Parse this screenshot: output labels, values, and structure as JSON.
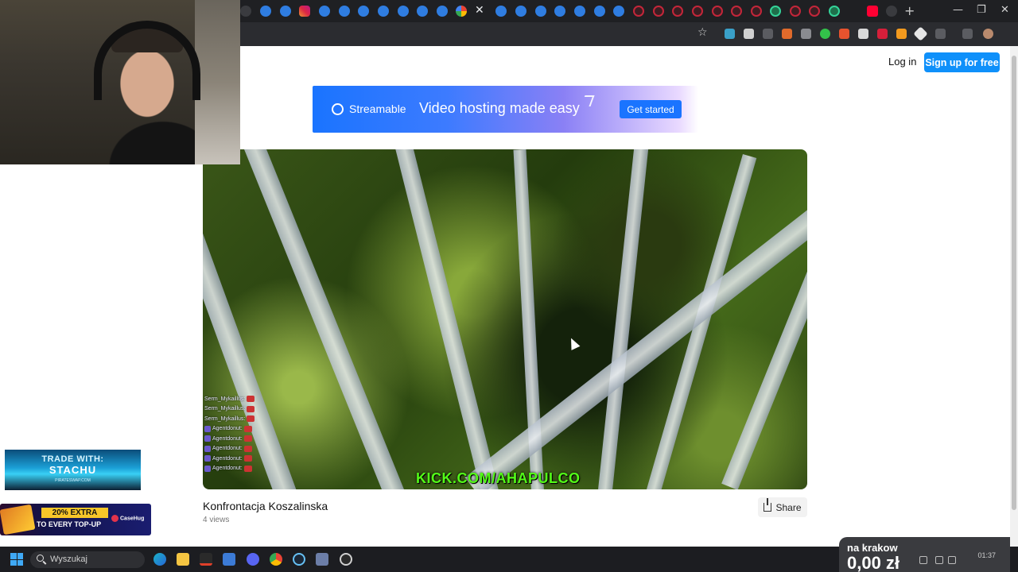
{
  "browser": {
    "toolbar_star": "☆",
    "new_tab": "+",
    "window_controls": {
      "minimize": "—",
      "restore": "❐",
      "close": "✕"
    },
    "active_tab_close": "✕"
  },
  "site": {
    "login_label": "Log in",
    "signup_label": "Sign up for free"
  },
  "banner": {
    "brand": "Streamable",
    "headline": "Video hosting made easy",
    "cta_label": "Get started"
  },
  "video": {
    "overlay_text": "KICK.COM/AHAPULCO",
    "title": "Konfrontacja Koszalinska",
    "views": "4 views",
    "share_label": "Share",
    "chat_names": [
      "Serm_Mykaillus:",
      "Serm_Mykaillus:",
      "Serm_Mykaillus:",
      "Agentdonut:",
      "Agentdonut:",
      "Agentdonut:",
      "Agentdonut:",
      "Agentdonut:"
    ]
  },
  "overlays": {
    "trade_line1": "TRADE WITH:",
    "trade_line2": "STACHU",
    "trade_line3": "PIRATESWAP.COM",
    "promo_line1": "20% EXTRA",
    "promo_line2": "TO EVERY TOP-UP",
    "promo_brand": "CaseHug"
  },
  "taskbar": {
    "search_placeholder": "Wyszukaj",
    "widget_location": "na krakow",
    "widget_amount": "0,00 zł",
    "time": "01:37"
  },
  "colors": {
    "accent": "#0f90fa",
    "kick_green": "#53fc18"
  }
}
